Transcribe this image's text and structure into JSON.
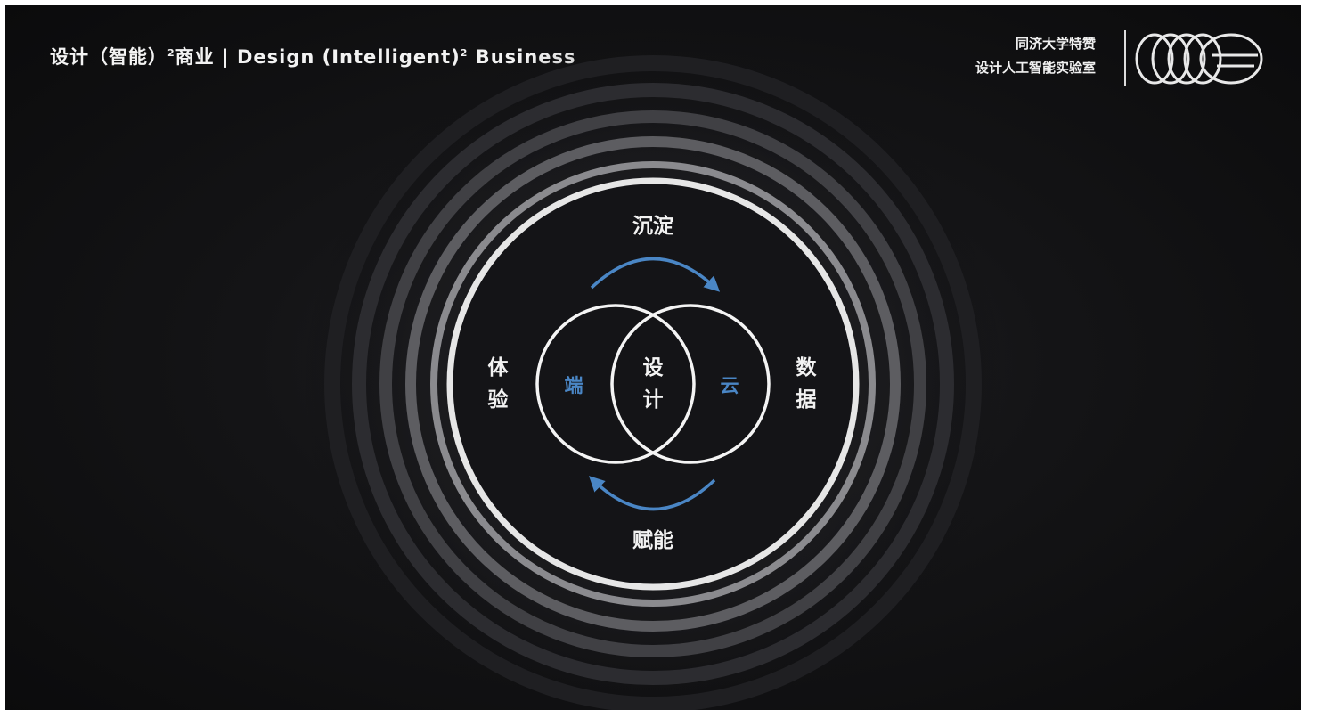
{
  "header": {
    "title_cn_a": "设计（智能）",
    "title_sup_a": "2",
    "title_cn_b": "商业 | Design (Intelligent)",
    "title_sup_b": "2",
    "title_en_c": " Business"
  },
  "lab": {
    "line1": "同济大学特赞",
    "line2": "设计人工智能实验室"
  },
  "diagram": {
    "top_label": "沉淀",
    "bottom_label": "赋能",
    "left_label_1": "体",
    "left_label_2": "验",
    "right_label_1": "数",
    "right_label_2": "据",
    "center_label_1": "设",
    "center_label_2": "计",
    "left_circle_label": "端",
    "right_circle_label": "云",
    "accent_color": "#4a86c5",
    "ring_color": "#e6e6e6"
  }
}
